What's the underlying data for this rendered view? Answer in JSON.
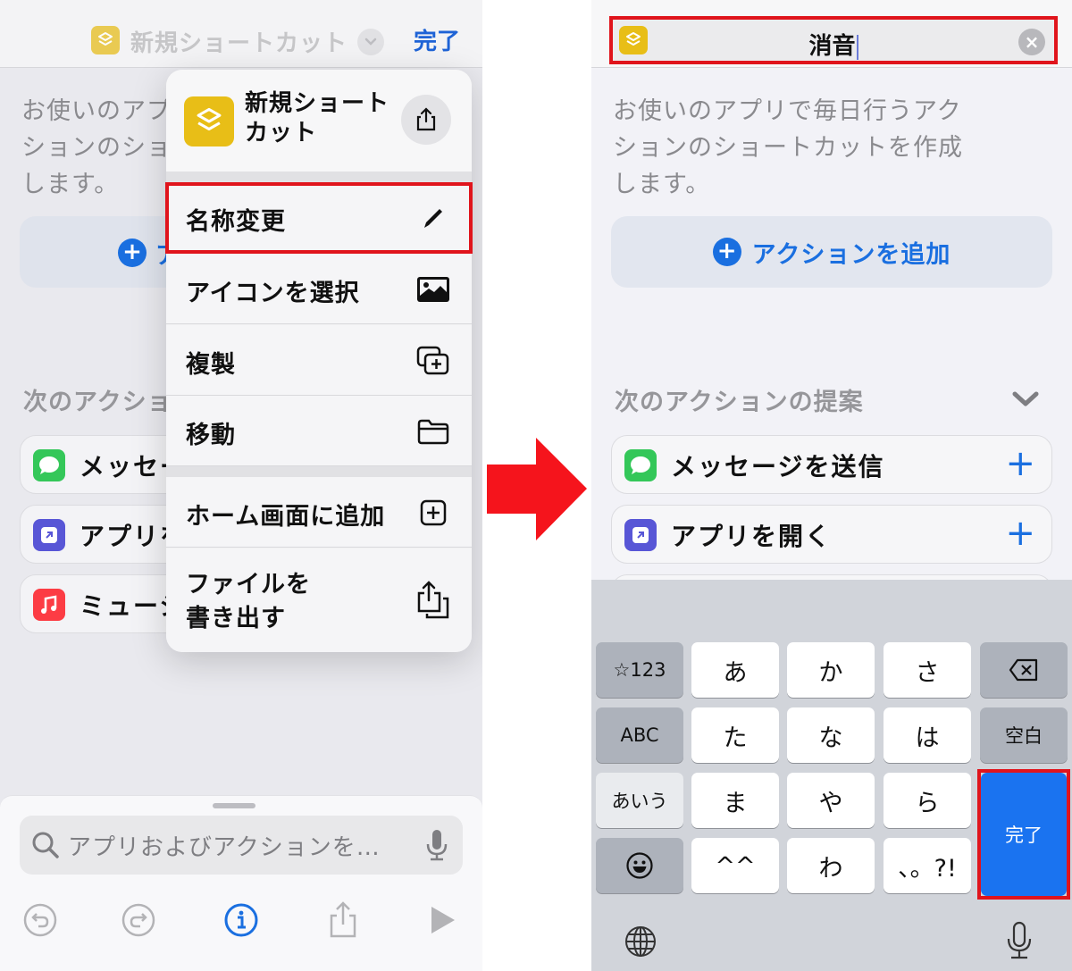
{
  "left": {
    "nav": {
      "title": "新規ショートカット",
      "done_label": "完了"
    },
    "description": "お使いのアプリで毎日行うアクションのショートカットを作成します。",
    "description_lines": [
      "お使いのアプ",
      "ションのショ",
      "します。"
    ],
    "add_action_visible": "ア",
    "suggestions_title": "次のアクションの提案",
    "suggestions_visible": "次のアクショ",
    "rows": [
      {
        "label": "メッセー",
        "icon": "messages-icon",
        "color": "#34c759"
      },
      {
        "label": "アプリを",
        "icon": "open-app-icon",
        "color": "#5856d6"
      },
      {
        "label": "ミュージ",
        "icon": "music-icon",
        "color": "#fc3c44"
      }
    ],
    "menu": {
      "title_line1": "新規ショート",
      "title_line2": "カット",
      "items": [
        {
          "label": "名称変更",
          "icon": "pencil-icon",
          "highlighted": true
        },
        {
          "label": "アイコンを選択",
          "icon": "photo-icon"
        },
        {
          "label": "複製",
          "icon": "duplicate-icon"
        },
        {
          "label": "移動",
          "icon": "folder-icon"
        },
        {
          "label": "ホーム画面に追加",
          "icon": "add-square-icon"
        },
        {
          "label_line1": "ファイルを",
          "label_line2": "書き出す",
          "icon": "export-icon"
        }
      ]
    },
    "search": {
      "placeholder": "アプリおよびアクションを…"
    },
    "toolbar": [
      "undo-icon",
      "redo-icon",
      "info-icon",
      "share-icon",
      "play-icon"
    ]
  },
  "right": {
    "name_field": {
      "value": "消音"
    },
    "description_lines": [
      "お使いのアプリで毎日行うアク",
      "ションのショートカットを作成",
      "します。"
    ],
    "add_action_label": "アクションを追加",
    "suggestions_title": "次のアクションの提案",
    "rows": [
      {
        "label": "メッセージを送信",
        "icon": "messages-icon",
        "color": "#34c759",
        "add": "+"
      },
      {
        "label": "アプリを開く",
        "icon": "open-app-icon",
        "color": "#5856d6",
        "add": "+"
      }
    ],
    "keyboard": {
      "row1": [
        "☆123",
        "あ",
        "か",
        "さ"
      ],
      "row2": [
        "ABC",
        "た",
        "な",
        "は",
        "空白"
      ],
      "row3": [
        "あいう",
        "ま",
        "や",
        "ら"
      ],
      "row4": [
        "^^",
        "わ",
        "、。?!"
      ],
      "done_label": "完了"
    }
  },
  "colors": {
    "accent": "#1a6fe0",
    "highlight": "#e0141c",
    "shortcut_icon": "#e8be17"
  }
}
